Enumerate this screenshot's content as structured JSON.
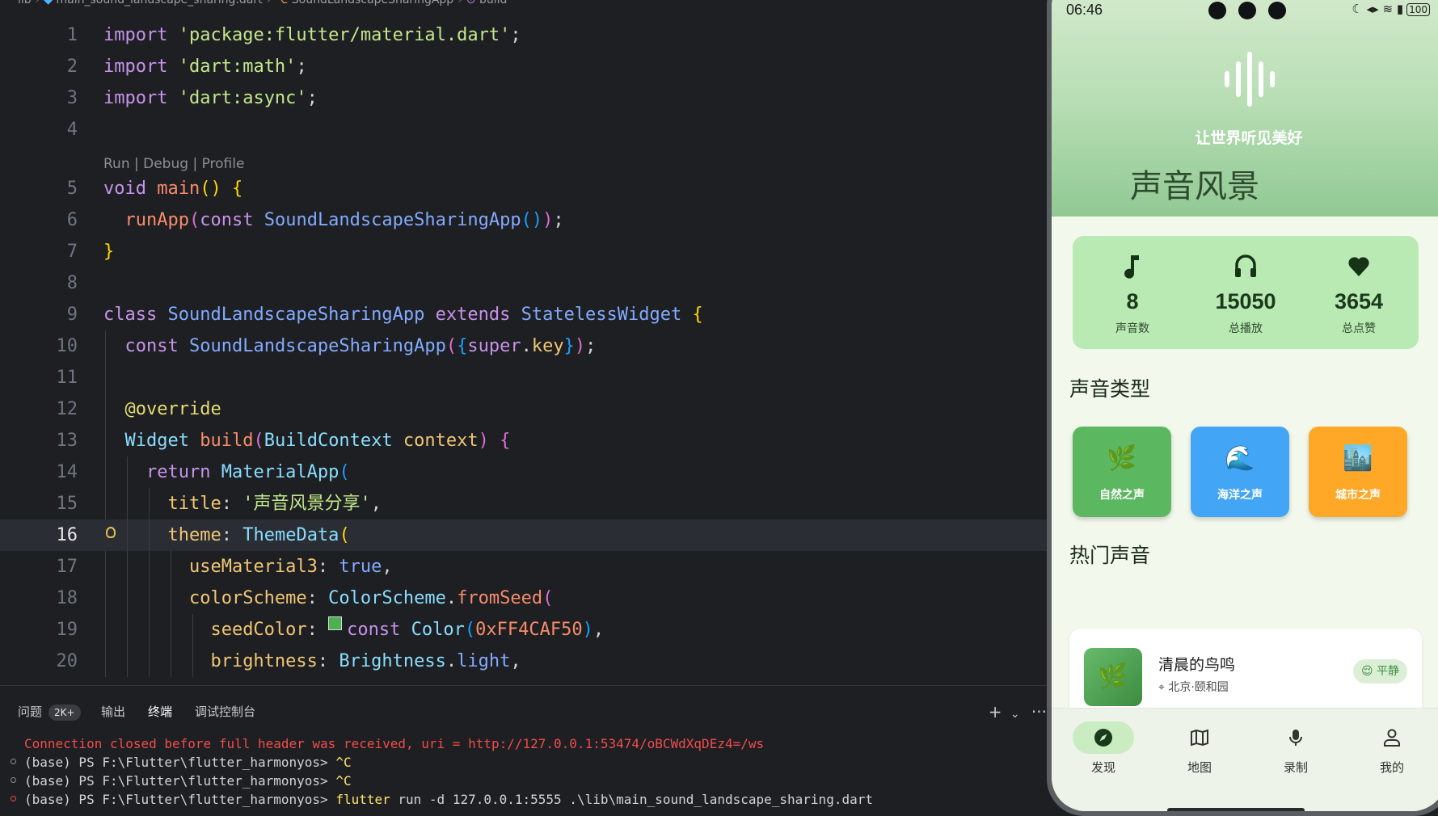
{
  "editor": {
    "breadcrumb": [
      "lib",
      "main_sound_landscape_sharing.dart",
      "SoundLandscapeSharingApp",
      "build"
    ],
    "codelens": "Run | Debug | Profile",
    "line_numbers": [
      "1",
      "2",
      "3",
      "4",
      "5",
      "6",
      "7",
      "8",
      "9",
      "10",
      "11",
      "12",
      "13",
      "14",
      "15",
      "16",
      "17",
      "18",
      "19",
      "20"
    ],
    "current_line": "16",
    "code": {
      "l1_kw": "import",
      "l1_str": " 'package:flutter/material.dart'",
      "l1_end": ";",
      "l2_kw": "import",
      "l2_str": " 'dart:math'",
      "l2_end": ";",
      "l3_kw": "import",
      "l3_str": " 'dart:async'",
      "l3_end": ";",
      "l5_kw": "void",
      "l5_fn": " main",
      "l5_p": "()",
      "l5_b": " {",
      "l6_fn": "runApp",
      "l6_p1": "(",
      "l6_kw": "const",
      "l6_cls": " SoundLandscapeSharingApp",
      "l6_p2": "()",
      "l6_p3": ")",
      "l6_end": ";",
      "l7_b": "}",
      "l9_kw": "class",
      "l9_cls": " SoundLandscapeSharingApp",
      "l9_kw2": " extends",
      "l9_cls2": " StatelessWidget",
      "l9_b": " {",
      "l10_kw": "const",
      "l10_cls": " SoundLandscapeSharingApp",
      "l10_p1": "(",
      "l10_b1": "{",
      "l10_super": "super",
      "l10_dot": ".",
      "l10_key": "key",
      "l10_b2": "}",
      "l10_p2": ")",
      "l10_end": ";",
      "l12_ann": "@override",
      "l13_cls": "Widget",
      "l13_fn": " build",
      "l13_p1": "(",
      "l13_cls2": "BuildContext",
      "l13_var": " context",
      "l13_p2": ")",
      "l13_b": " {",
      "l14_kw": "return",
      "l14_cls": " MaterialApp",
      "l14_p": "(",
      "l15_prop": "title",
      "l15_col": ": ",
      "l15_str": "'声音风景分享'",
      "l15_end": ",",
      "l16_prop": "theme",
      "l16_col": ": ",
      "l16_cls": "ThemeData",
      "l16_p": "(",
      "l17_prop": "useMaterial3",
      "l17_col": ": ",
      "l17_bool": "true",
      "l17_end": ",",
      "l18_prop": "colorScheme",
      "l18_col": ": ",
      "l18_cls": "ColorScheme",
      "l18_dot": ".",
      "l18_fn": "fromSeed",
      "l18_p": "(",
      "l19_prop": "seedColor",
      "l19_col": ": ",
      "l19_kw": "const",
      "l19_cls": " Color",
      "l19_p1": "(",
      "l19_num": "0xFF4CAF50",
      "l19_p2": ")",
      "l19_end": ",",
      "l20_prop": "brightness",
      "l20_col": ": ",
      "l20_cls": "Brightness",
      "l20_dot": ".",
      "l20_val": "light",
      "l20_end": ","
    },
    "seed_swatch_color": "#4CAF50"
  },
  "panel": {
    "tabs": [
      {
        "label": "问题",
        "badge": "2K+"
      },
      {
        "label": "输出"
      },
      {
        "label": "终端"
      },
      {
        "label": "调试控制台"
      }
    ],
    "active_tab": "终端",
    "actions": {
      "add": "+",
      "dropdown": "⌄",
      "more": "···"
    },
    "terminal": {
      "line1": "Connection closed before full header was received, uri = http://127.0.0.1:53474/oBCWdXqDEz4=/ws",
      "line2_prompt": "(base) PS F:\\Flutter\\flutter_harmonyos> ",
      "line2_cmd": "^C",
      "line3_prompt": "(base) PS F:\\Flutter\\flutter_harmonyos> ",
      "line3_cmd": "^C",
      "line4_prompt": "(base) PS F:\\Flutter\\flutter_harmonyos> ",
      "line4_cmd": "flutter",
      "line4_args": " run -d 127.0.0.1:5555 .\\lib\\main_sound_landscape_sharing.dart"
    }
  },
  "phone": {
    "status": {
      "time": "06:46",
      "battery": "100"
    },
    "slogan": "让世界听见美好",
    "title": "声音风景",
    "stats": [
      {
        "icon": "music-note-icon",
        "value": "8",
        "label": "声音数"
      },
      {
        "icon": "headphones-icon",
        "value": "15050",
        "label": "总播放"
      },
      {
        "icon": "heart-icon",
        "value": "3654",
        "label": "总点赞"
      }
    ],
    "categories_title": "声音类型",
    "categories": [
      {
        "emoji": "🌿",
        "label": "自然之声",
        "color": "#5cb860"
      },
      {
        "emoji": "🌊",
        "label": "海洋之声",
        "color": "#42a5f5"
      },
      {
        "emoji": "🏙️",
        "label": "城市之声",
        "color": "#ffa726"
      }
    ],
    "popular_title": "热门声音",
    "sound": {
      "emoji": "🌿",
      "title": "清晨的鸟鸣",
      "location": "北京·颐和园",
      "mood": "😌 平静"
    },
    "nav": [
      {
        "icon": "compass-icon",
        "label": "发现"
      },
      {
        "icon": "map-icon",
        "label": "地图"
      },
      {
        "icon": "microphone-icon",
        "label": "录制"
      },
      {
        "icon": "person-icon",
        "label": "我的"
      }
    ],
    "active_nav": "发现"
  }
}
